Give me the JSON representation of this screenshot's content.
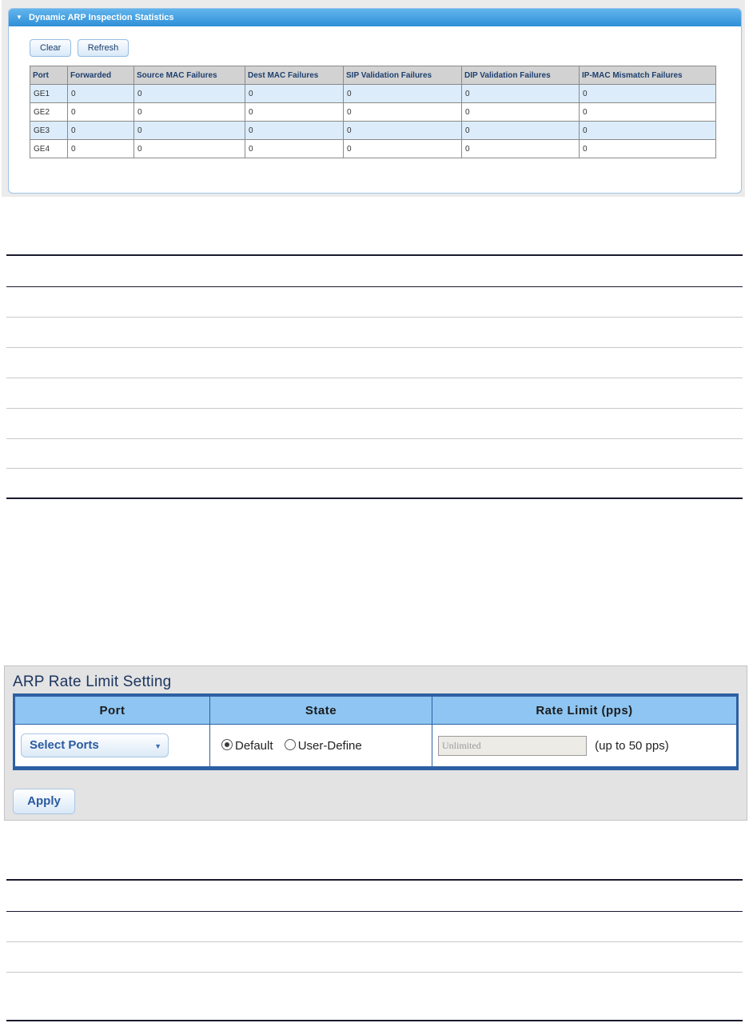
{
  "dai": {
    "title": "Dynamic ARP Inspection Statistics",
    "buttons": {
      "clear": "Clear",
      "refresh": "Refresh"
    },
    "columns": [
      "Port",
      "Forwarded",
      "Source MAC Failures",
      "Dest MAC Failures",
      "SIP Validation Failures",
      "DIP Validation Failures",
      "IP-MAC Mismatch Failures"
    ],
    "rows": [
      [
        "GE1",
        "0",
        "0",
        "0",
        "0",
        "0",
        "0"
      ],
      [
        "GE2",
        "0",
        "0",
        "0",
        "0",
        "0",
        "0"
      ],
      [
        "GE3",
        "0",
        "0",
        "0",
        "0",
        "0",
        "0"
      ],
      [
        "GE4",
        "0",
        "0",
        "0",
        "0",
        "0",
        "0"
      ]
    ]
  },
  "rate_limit": {
    "title": "ARP Rate Limit Setting",
    "columns": {
      "port": "Port",
      "state": "State",
      "rate": "Rate Limit (pps)"
    },
    "select_ports": "Select Ports",
    "state_options": {
      "default": "Default",
      "user_define": "User-Define"
    },
    "selected_state": "Default",
    "rate_value": "Unlimited",
    "rate_hint": "(up to 50 pps)",
    "apply": "Apply"
  },
  "icons": {
    "collapse": "triangle-down-icon",
    "dropdown": "chevron-down-icon"
  }
}
